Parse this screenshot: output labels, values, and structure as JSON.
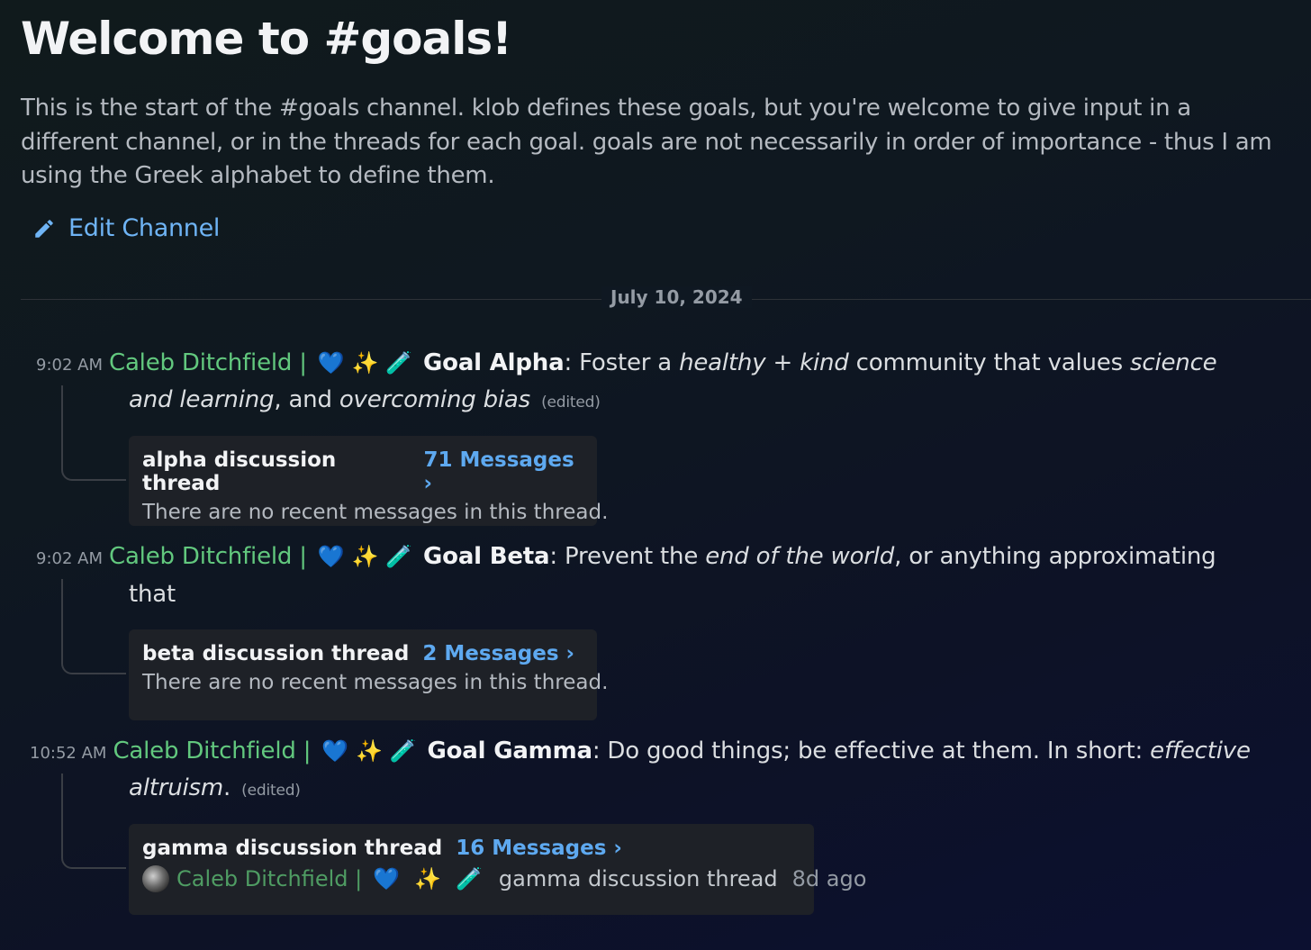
{
  "header": {
    "title": "Welcome to #goals!",
    "description": "This is the start of the #goals channel. klob defines these goals, but you're welcome to give input in a different channel, or in the threads for each goal. goals are not necessarily in order of importance - thus I am using the Greek alphabet to define them.",
    "edit_label": "Edit Channel"
  },
  "date_divider": "July 10, 2024",
  "messages": [
    {
      "time": "9:02 AM",
      "author": "Caleb Ditchfield |",
      "goal": "Goal Alpha",
      "line1_a": ": Foster a ",
      "line1_italic1": "healthy + kind",
      "line1_b": " community that values ",
      "line1_italic2": "science",
      "line2_italic1": "and learning",
      "line2_a": ", and ",
      "line2_italic2": "overcoming bias",
      "edited": "(edited)",
      "thread": {
        "name": "alpha discussion thread",
        "count": "71 Messages ›",
        "body": "There are no recent messages in this thread."
      }
    },
    {
      "time": "9:02 AM",
      "author": "Caleb Ditchfield |",
      "goal": "Goal Beta",
      "line1_a": ": Prevent the ",
      "line1_italic1": "end of the world",
      "line1_b": ", or anything approximating",
      "line2_a": "that",
      "thread": {
        "name": "beta discussion thread",
        "count": "2 Messages ›",
        "body": "There are no recent messages in this thread."
      }
    },
    {
      "time": "10:52 AM",
      "author": "Caleb Ditchfield |",
      "goal": "Goal Gamma",
      "line1_a": ": Do good things; be effective at them. In short: ",
      "line1_italic1": "effective",
      "line2_italic1": "altruism",
      "line2_a": ".",
      "edited": "(edited)",
      "thread": {
        "name": "gamma discussion thread",
        "count": "16 Messages ›",
        "recent_author": "Caleb Ditchfield |",
        "recent_text": "gamma discussion thread",
        "recent_time": "8d ago"
      }
    }
  ],
  "emojis": {
    "heart": "💙",
    "sparkles": "✨",
    "test_tube": "🧪"
  },
  "colors": {
    "author": "#62c87e",
    "link": "#6fb4f5",
    "thread_count": "#5ea9f0",
    "card_bg": "#1e2127"
  }
}
